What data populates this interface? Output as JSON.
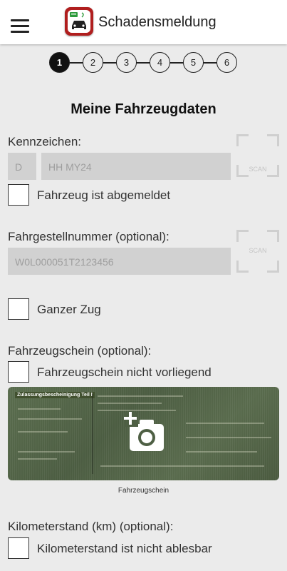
{
  "app": {
    "title": "Schadensmeldung",
    "menu_icon": "hamburger-menu-icon",
    "logo_icon": "app-logo-car-icon"
  },
  "stepper": {
    "current_step": 1,
    "steps": [
      "1",
      "2",
      "3",
      "4",
      "5",
      "6"
    ]
  },
  "page": {
    "heading": "Meine Fahrzeugdaten"
  },
  "plate": {
    "label": "Kennzeichen:",
    "country_code": "D",
    "number": "HH MY24",
    "scan_label": "SCAN",
    "deregistered_label": "Fahrzeug ist abgemeldet",
    "deregistered_checked": false
  },
  "vin": {
    "label": "Fahrgestellnummer (optional):",
    "value": "W0L000051T2123456",
    "scan_label": "SCAN"
  },
  "whole_train": {
    "label": "Ganzer Zug",
    "checked": false
  },
  "registration_doc": {
    "label": "Fahrzeugschein (optional):",
    "not_available_label": "Fahrzeugschein nicht vorliegend",
    "not_available_checked": false,
    "image_title": "Zulassungsbescheinigung Teil I",
    "add_photo_icon": "add-photo-camera-icon",
    "caption": "Fahrzeugschein"
  },
  "mileage": {
    "label": "Kilometerstand (km) (optional):",
    "not_readable_label": "Kilometerstand ist nicht ablesbar",
    "not_readable_checked": false
  },
  "colors": {
    "background": "#ebebeb",
    "topbar": "#ffffff",
    "field": "#d1d1d1",
    "field_text": "#9e9e9e",
    "logo_red": "#b01e1e",
    "active_step": "#111111"
  }
}
